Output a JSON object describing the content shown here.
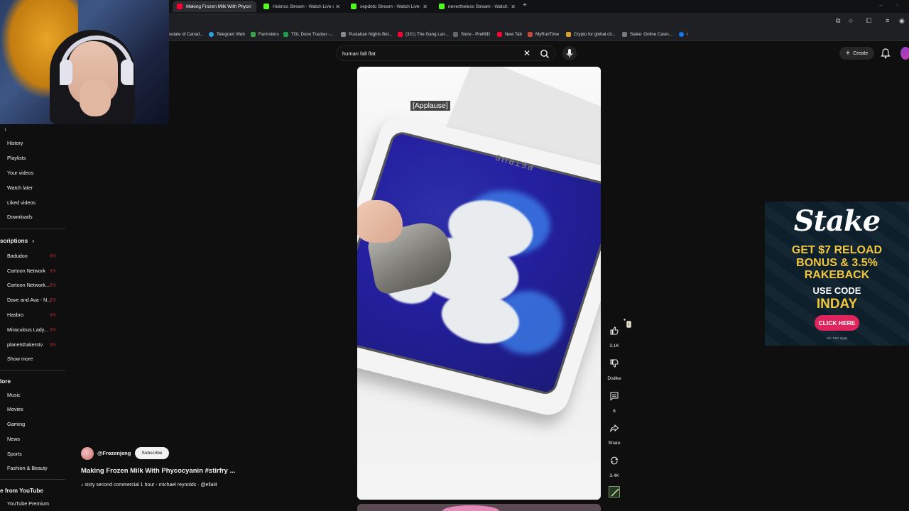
{
  "browser": {
    "tabs": [
      {
        "label": "Making Frozen Milk With Phyco",
        "favicon_color": "#ff0033",
        "active": true
      },
      {
        "label": "Hubriss Stream - Watch Live o",
        "favicon_color": "#53fc18",
        "active": false
      },
      {
        "label": "sepdoto Stream - Watch Live o",
        "favicon_color": "#53fc18",
        "active": false
      },
      {
        "label": "nevertheless Stream - Watch Li",
        "favicon_color": "#53fc18",
        "active": false
      }
    ],
    "new_tab_symbol": "+",
    "bookmarks": [
      {
        "label": "sulate of Canad...",
        "color": "#444"
      },
      {
        "label": "Telegram Web",
        "color": "#2aa3e0"
      },
      {
        "label": "Farmskins",
        "color": "#3fa34d"
      },
      {
        "label": "TGL Dono Tracker -...",
        "color": "#1e9d4a"
      },
      {
        "label": "Pustahan Nights Bet...",
        "color": "#888"
      },
      {
        "label": "(321) The Gang Lan...",
        "color": "#ff0033"
      },
      {
        "label": "Store - PreMiD",
        "color": "#666"
      },
      {
        "label": "New Tab",
        "color": "#ff0033"
      },
      {
        "label": "MyRunTime",
        "color": "#c4483b"
      },
      {
        "label": "Crypto for global cit...",
        "color": "#d6a12a"
      },
      {
        "label": "Stake: Online Casin...",
        "color": "#777"
      },
      {
        "label": "i",
        "color": "#1877f2"
      }
    ]
  },
  "masthead": {
    "search_value": "human fall flat",
    "create_label": "Create"
  },
  "sidebar": {
    "you_items": [
      "History",
      "Playlists",
      "Your videos",
      "Watch later",
      "Liked videos",
      "Downloads"
    ],
    "subscriptions_heading": "scriptions",
    "subscriptions": [
      "Badudoo",
      "Cartoon Network",
      "Cartoon Network...",
      "Dave and Ava - N...",
      "Hasbro",
      "Miraculous Lady...",
      "planetshakerstv"
    ],
    "show_more": "Show more",
    "explore_heading": "lore",
    "explore": [
      "Music",
      "Movies",
      "Gaming",
      "News",
      "Sports",
      "Fashion & Beauty"
    ],
    "more_heading": "e from YouTube",
    "more_items": [
      "YouTube Premium"
    ]
  },
  "short": {
    "caption": "[Applause]",
    "brand_text": "PETRUS",
    "channel": "@Frozenjeng",
    "subscribe_label": "Subscribe",
    "title": "Making Frozen Milk With Phycocyanin #stirfry ...",
    "sound": "sixty second commercial 1 hour - michael reynolds · @ellal4",
    "actions": {
      "like_count": "3.1K",
      "dislike_label": "Dislike",
      "comments_count": "6",
      "share_label": "Share",
      "remix_count": "3.4K"
    }
  },
  "ad": {
    "logo": "Stake",
    "line1": "GET $7 RELOAD",
    "line2": "BONUS & 3.5%",
    "line3": "RAKEBACK",
    "use_code": "USE CODE",
    "code": "INDAY",
    "cta": "CLICK HERE",
    "fine_print": "18+ T&C apply",
    "colors": {
      "background": "#0d1f2b",
      "accent": "#f3c640",
      "cta": "#e0245e"
    }
  }
}
